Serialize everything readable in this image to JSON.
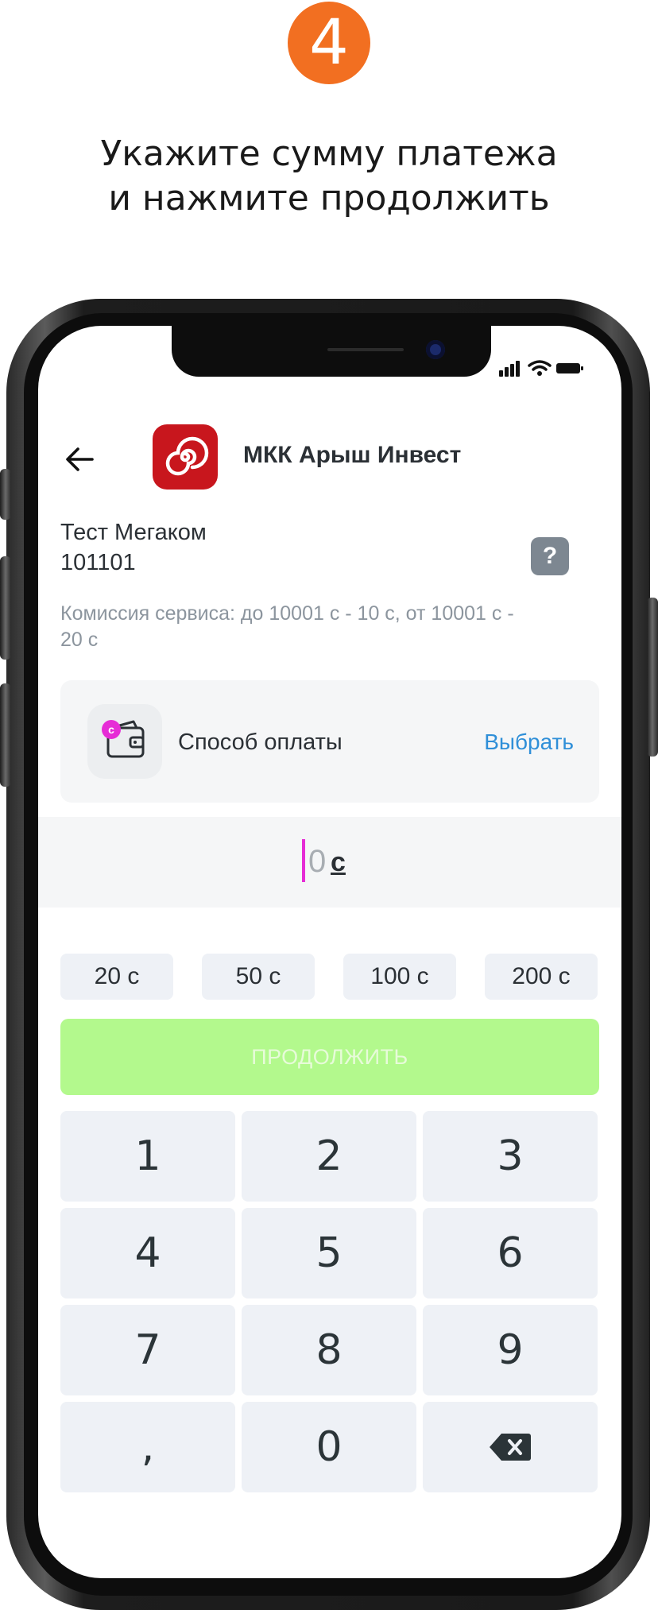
{
  "step_number": "4",
  "heading": {
    "line1": "Укажите сумму платежа",
    "line2": "и нажмите продолжить"
  },
  "header": {
    "back_icon": "arrow-left-icon",
    "merchant_name": "МКК Арыш Инвест",
    "logo_color": "#c8161d"
  },
  "account": {
    "name": "Тест Мегаком",
    "number": "101101",
    "help_label": "?",
    "commission": "Комиссия сервиса: до 10001 с - 10 с, от 10001 с - 20 с"
  },
  "payment_method": {
    "icon": "wallet-icon",
    "coin_label": "с",
    "label": "Способ оплаты",
    "action": "Выбрать"
  },
  "amount": {
    "value": "0",
    "currency": "с"
  },
  "quick_amounts": [
    "20 с",
    "50 с",
    "100 с",
    "200 с"
  ],
  "continue_button": {
    "label": "ПРОДОЛЖИТЬ",
    "color": "#b3f98d",
    "enabled": false
  },
  "keypad": {
    "keys": [
      "1",
      "2",
      "3",
      "4",
      "5",
      "6",
      "7",
      "8",
      "9",
      ",",
      "0"
    ],
    "backspace_icon": "backspace-icon"
  },
  "colors": {
    "accent_orange": "#f26f21",
    "link_blue": "#2f8fd8",
    "cursor_pink": "#e62cd6"
  }
}
